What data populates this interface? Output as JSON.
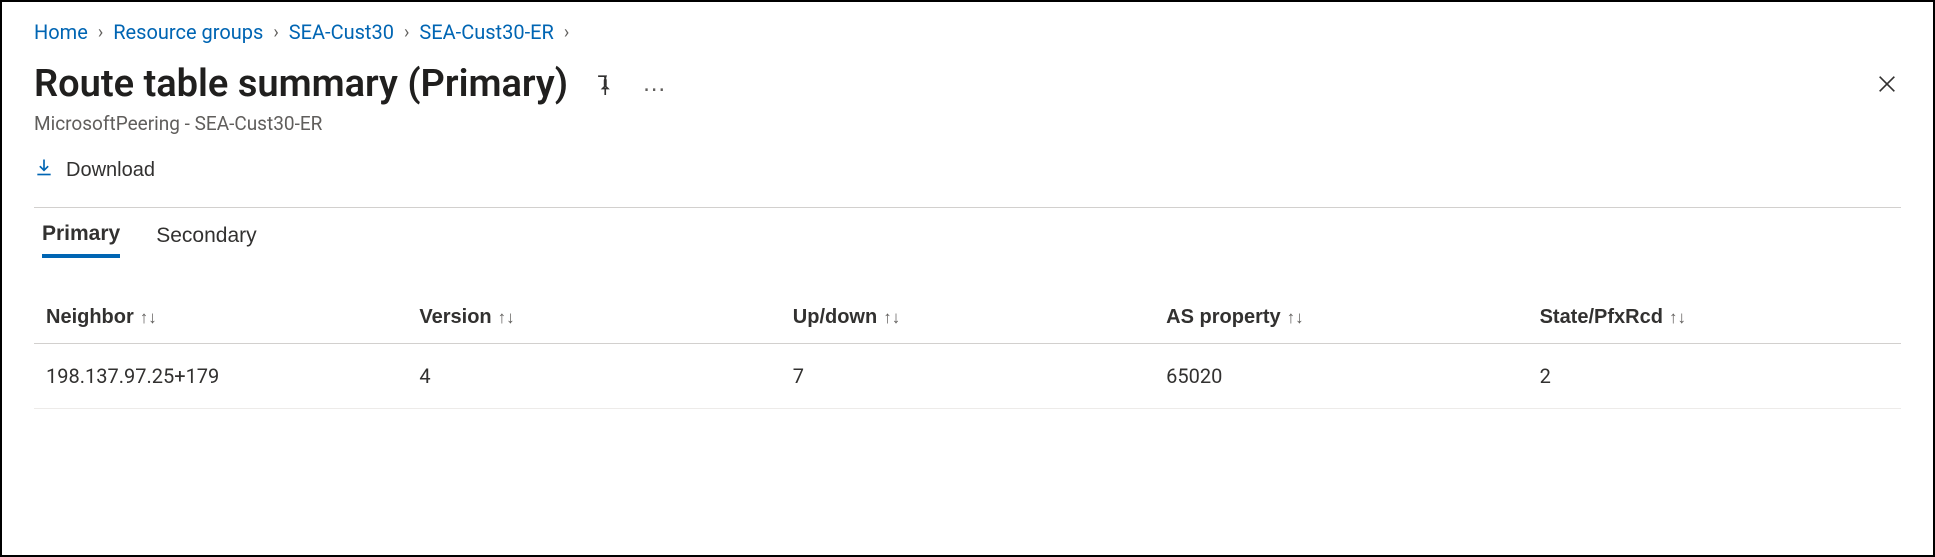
{
  "breadcrumb": [
    {
      "label": "Home"
    },
    {
      "label": "Resource groups"
    },
    {
      "label": "SEA-Cust30"
    },
    {
      "label": "SEA-Cust30-ER"
    }
  ],
  "page": {
    "title": "Route table summary (Primary)",
    "subtitle": "MicrosoftPeering - SEA-Cust30-ER"
  },
  "toolbar": {
    "download_label": "Download"
  },
  "tabs": [
    {
      "label": "Primary",
      "active": true
    },
    {
      "label": "Secondary",
      "active": false
    }
  ],
  "table": {
    "columns": [
      {
        "label": "Neighbor"
      },
      {
        "label": "Version"
      },
      {
        "label": "Up/down"
      },
      {
        "label": "AS property"
      },
      {
        "label": "State/PfxRcd"
      }
    ],
    "rows": [
      {
        "neighbor": "198.137.97.25+179",
        "version": "4",
        "updown": "7",
        "as_property": "65020",
        "state_pfxrcd": "2"
      }
    ]
  }
}
